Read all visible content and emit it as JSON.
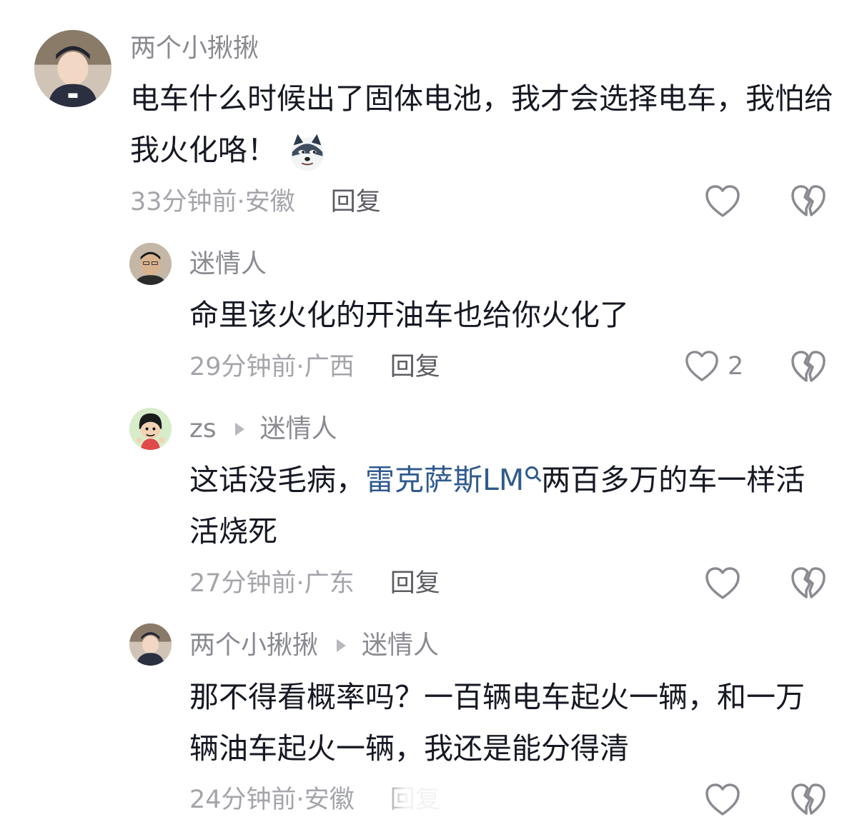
{
  "comments": [
    {
      "username": "两个小揪揪",
      "text": "电车什么时候出了固体电池，我才会选择电车，我怕给我火化咯！",
      "emoji": "doge-emoji",
      "time": "33分钟前",
      "location": "安徽",
      "reply_label": "回复",
      "like_count": ""
    },
    {
      "username": "迷情人",
      "text": "命里该火化的开油车也给你火化了",
      "time": "29分钟前",
      "location": "广西",
      "reply_label": "回复",
      "like_count": "2"
    },
    {
      "username": "zs",
      "reply_to": "迷情人",
      "text_before": "这话没毛病，",
      "link_text": "雷克萨斯LM",
      "text_after": "两百多万的车一样活活烧死",
      "time": "27分钟前",
      "location": "广东",
      "reply_label": "回复",
      "like_count": ""
    },
    {
      "username": "两个小揪揪",
      "reply_to": "迷情人",
      "text": "那不得看概率吗？一百辆电车起火一辆，和一万辆油车起火一辆，我还是能分得清",
      "time": "24分钟前",
      "location": "安徽",
      "reply_label": "回复",
      "like_count": ""
    }
  ],
  "separator": " · ",
  "icons": {
    "like": "heart-outline-icon",
    "dislike": "broken-heart-icon",
    "search": "search-icon"
  },
  "colors": {
    "text": "#161823",
    "meta": "#a4a5aa",
    "username": "#8a8b91",
    "link": "#2f5b8e"
  }
}
